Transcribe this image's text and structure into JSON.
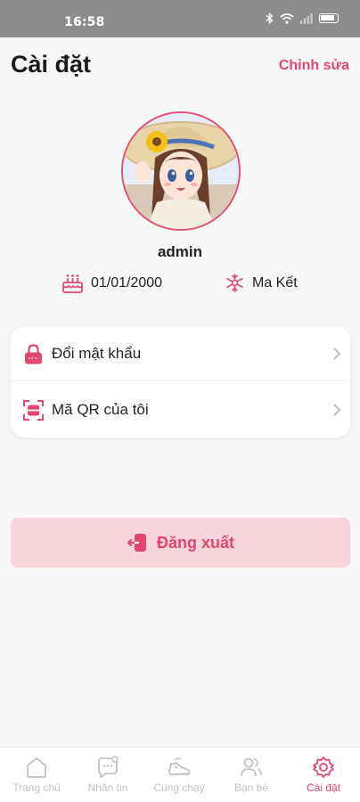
{
  "status_bar": {
    "time": "16:58"
  },
  "header": {
    "title": "Cài đặt",
    "edit_label": "Chỉnh sửa"
  },
  "profile": {
    "username": "admin",
    "birthday": "01/01/2000",
    "zodiac": "Ma Kết",
    "avatar_icon": "anime-girl-avatar"
  },
  "menu": {
    "items": [
      {
        "label": "Đổi mật khẩu",
        "icon": "lock-icon"
      },
      {
        "label": "Mã QR của tôi",
        "icon": "qr-scan-icon"
      }
    ]
  },
  "logout": {
    "label": "Đăng xuất",
    "icon": "logout-icon"
  },
  "bottom_nav": {
    "items": [
      {
        "label": "Trang chủ",
        "icon": "home-icon",
        "active": false
      },
      {
        "label": "Nhắn tin",
        "icon": "chat-icon",
        "active": false
      },
      {
        "label": "Cùng chạy",
        "icon": "shoe-icon",
        "active": false
      },
      {
        "label": "Bạn bè",
        "icon": "friends-icon",
        "active": false
      },
      {
        "label": "Cài đặt",
        "icon": "settings-icon",
        "active": true
      }
    ]
  },
  "colors": {
    "accent": "#e2466e",
    "logout_bg": "#f7d4dc",
    "page_bg": "#f7f7f7",
    "status_bar": "#8c8c8c"
  }
}
